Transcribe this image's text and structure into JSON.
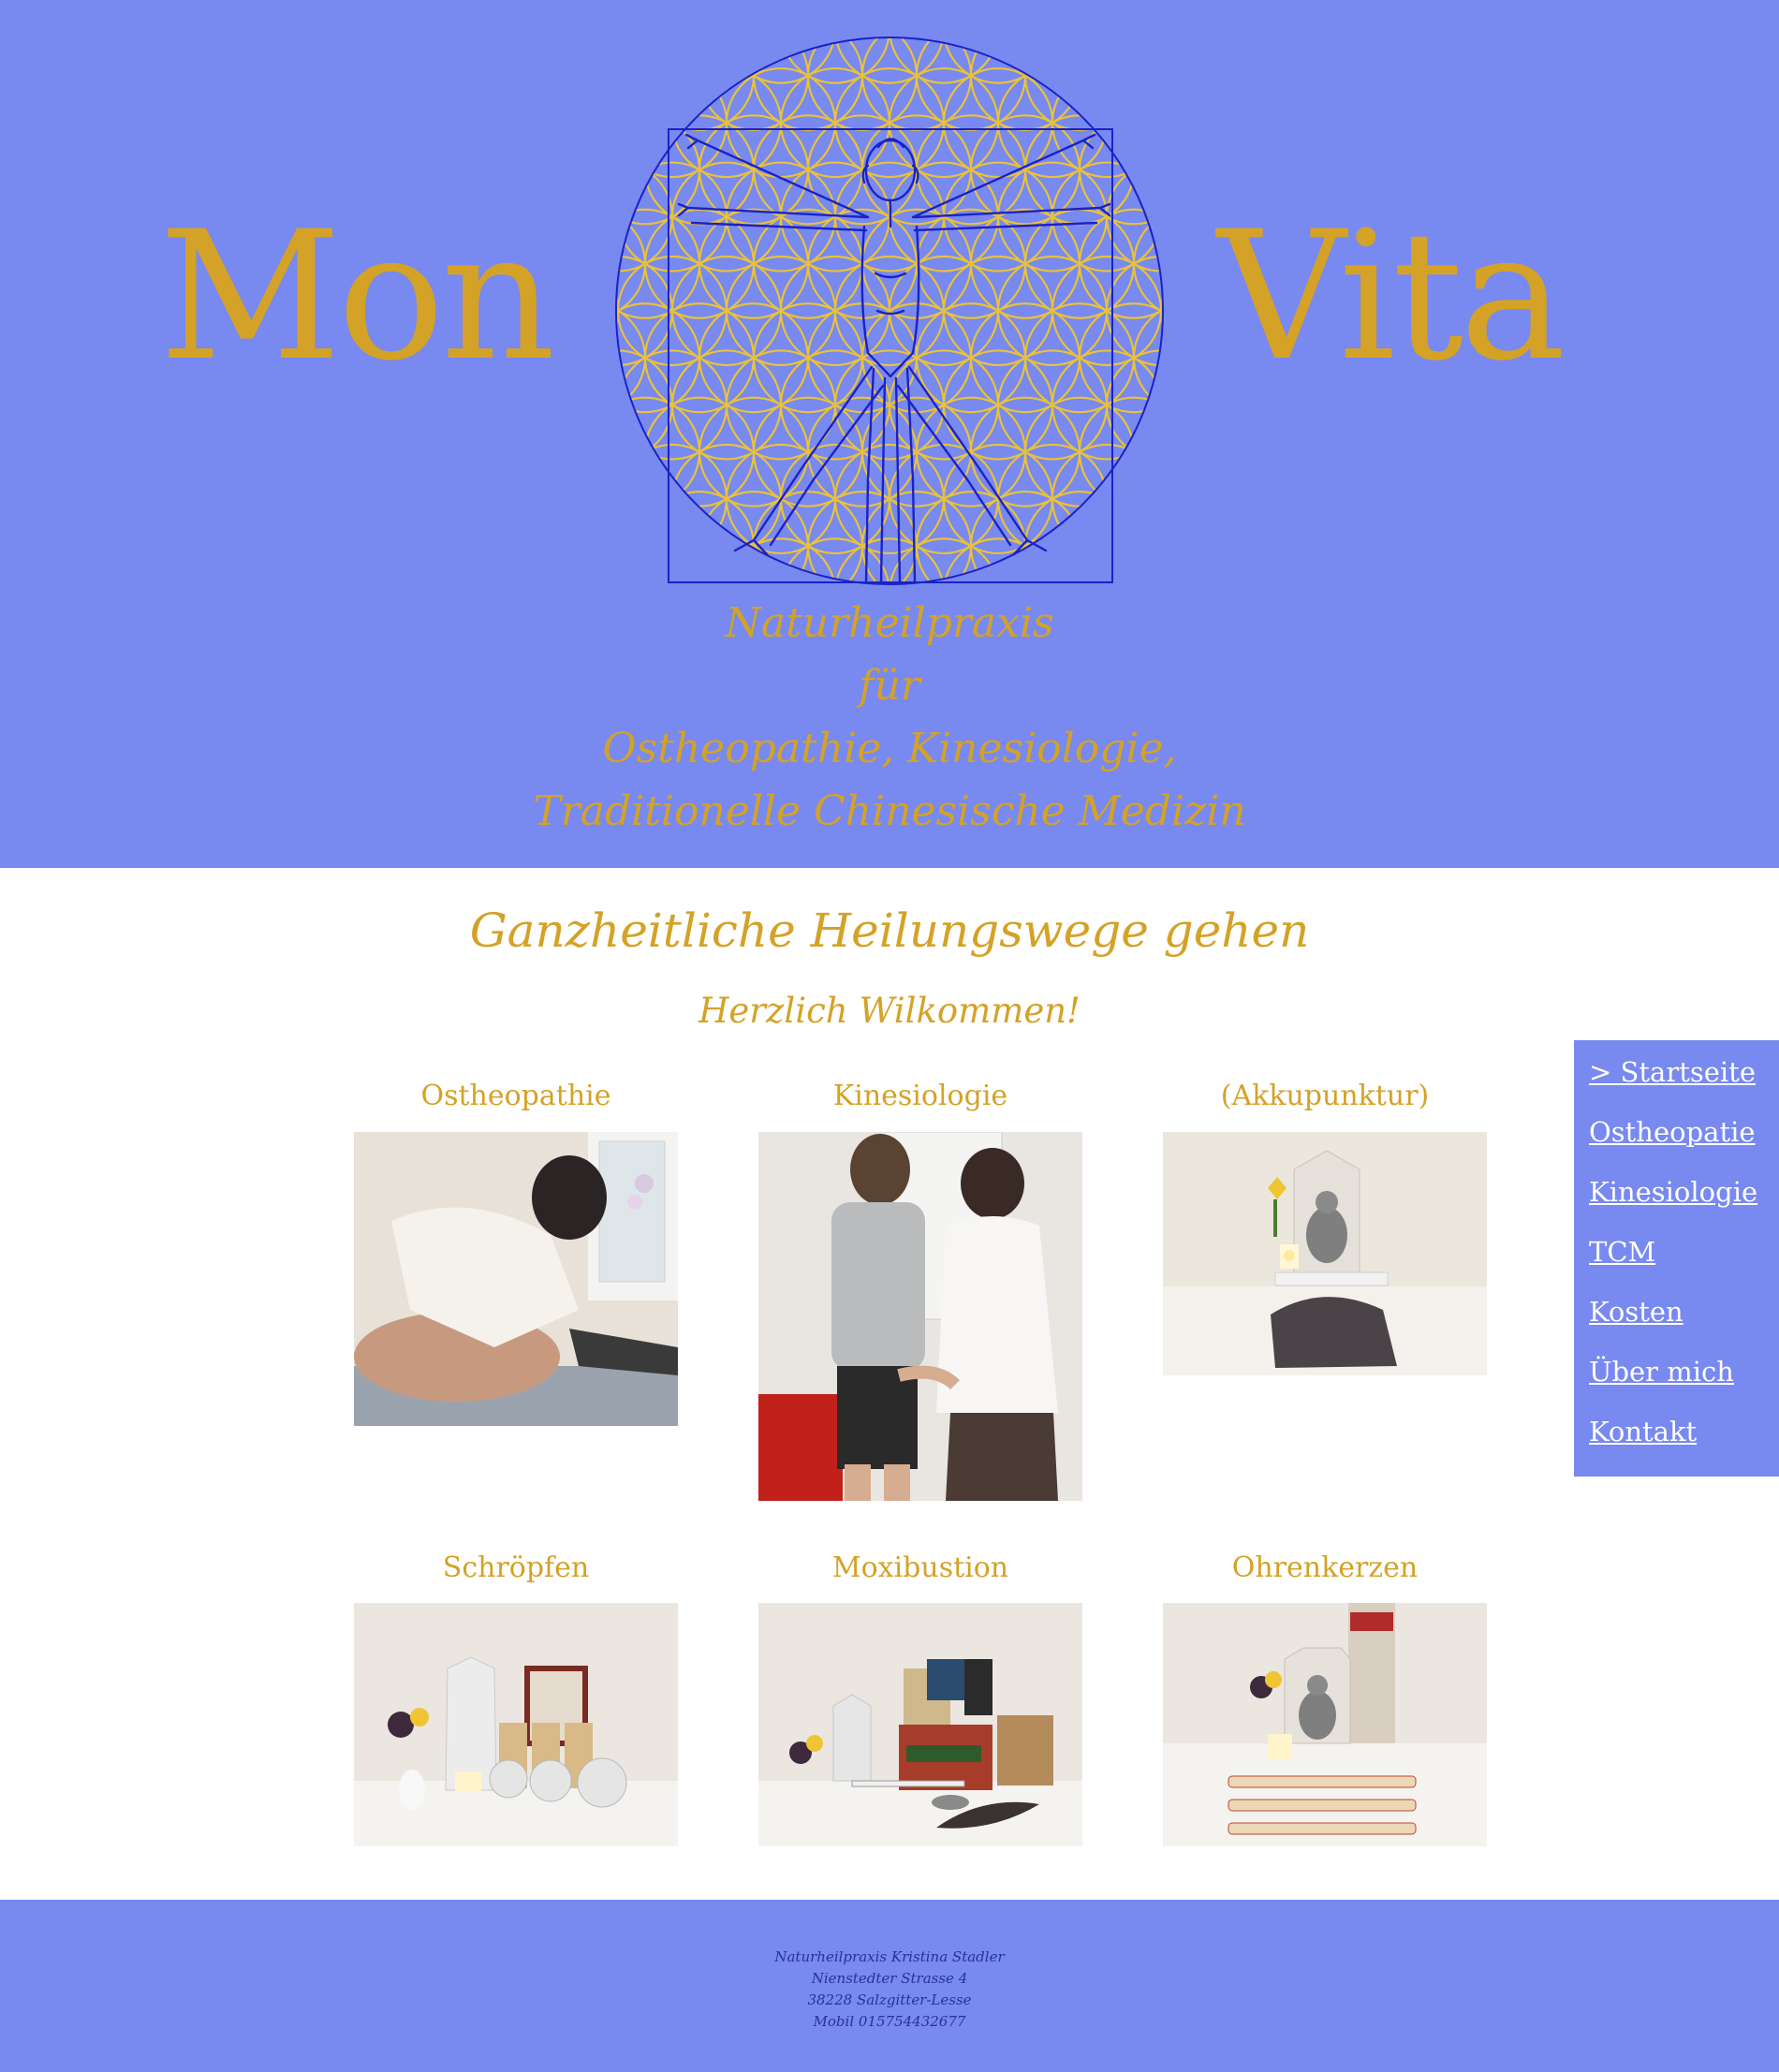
{
  "brand": {
    "word_left": "Mon",
    "word_right": "Vita",
    "logo_icon": "vitruvian-flower-of-life-icon"
  },
  "tagline": {
    "line1": "Naturheilpraxis",
    "line2": "für",
    "line3": "Ostheopathie, Kinesiologie,",
    "line4": "Traditionelle Chinesische Medizin"
  },
  "main": {
    "headline": "Ganzheitliche Heilungswege gehen",
    "welcome": "Herzlich Wilkommen!",
    "tiles": [
      {
        "title": "Ostheopathie",
        "image": "osteopathy-treatment-photo"
      },
      {
        "title": "Kinesiologie",
        "image": "kinesiology-muscle-test-photo"
      },
      {
        "title": "(Akkupunktur)",
        "image": "acupuncture-altar-photo"
      },
      {
        "title": "Schröpfen",
        "image": "cupping-glasses-photo"
      },
      {
        "title": "Moxibustion",
        "image": "moxibustion-tools-photo"
      },
      {
        "title": "Ohrenkerzen",
        "image": "ear-candles-photo"
      }
    ]
  },
  "nav": {
    "items": [
      {
        "label": "> Startseite",
        "active": true
      },
      {
        "label": "Ostheopatie"
      },
      {
        "label": "Kinesiologie"
      },
      {
        "label": "TCM"
      },
      {
        "label": "Kosten"
      },
      {
        "label": "Über mich"
      },
      {
        "label": "Kontakt"
      }
    ]
  },
  "footer": {
    "line1": "Naturheilpraxis Kristina Stadler",
    "line2": "Nienstedter Strasse 4",
    "line3": "38228 Salzgitter-Lesse",
    "line4": "Mobil 015754432677"
  },
  "colors": {
    "header_bg": "#7889f0",
    "gold": "#d4a226",
    "logo_blue": "#1a22c8",
    "footer_text": "#26319e",
    "nav_text": "#ffffff"
  }
}
